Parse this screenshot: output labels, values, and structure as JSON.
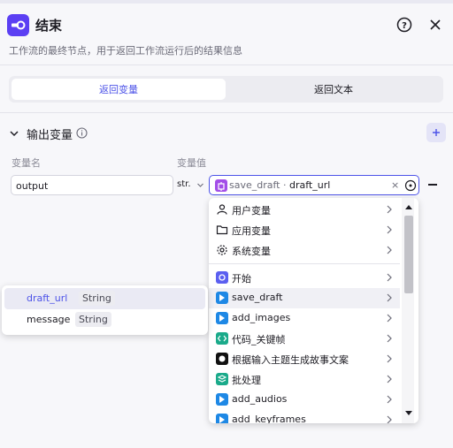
{
  "header": {
    "title": "结束",
    "description": "工作流的最终节点，用于返回工作流运行后的结果信息",
    "icon": "exit-icon",
    "accent": "#5b3ff3"
  },
  "tabs": [
    {
      "label": "返回变量",
      "active": true
    },
    {
      "label": "返回文本",
      "active": false
    }
  ],
  "section": {
    "title": "输出变量",
    "add_label": "+"
  },
  "columns": {
    "name": "变量名",
    "value": "变量值"
  },
  "row": {
    "name": "output",
    "type": "str.",
    "ref_node": "save_draft",
    "ref_sep": "·",
    "ref_field": "draft_url",
    "clear": "×"
  },
  "dropdown": {
    "groups": [
      {
        "label": "用户变量",
        "icon": "user-icon"
      },
      {
        "label": "应用变量",
        "icon": "folder-icon"
      },
      {
        "label": "系统变量",
        "icon": "gear-icon"
      }
    ],
    "nodes": [
      {
        "label": "开始",
        "icon": "start-icon",
        "color": "#5b5ff0"
      },
      {
        "label": "save_draft",
        "icon": "plugin-icon",
        "color": "#1e88e5",
        "highlighted": true
      },
      {
        "label": "add_images",
        "icon": "plugin-icon",
        "color": "#1e88e5"
      },
      {
        "label": "代码_关键帧",
        "icon": "code-icon",
        "color": "#1aaa8a"
      },
      {
        "label": "根据输入主题生成故事文案",
        "icon": "llm-icon",
        "color": "#111111"
      },
      {
        "label": "批处理",
        "icon": "batch-icon",
        "color": "#1aaa8a"
      },
      {
        "label": "add_audios",
        "icon": "plugin-icon",
        "color": "#1e88e5"
      },
      {
        "label": "add_keyframes",
        "icon": "plugin-icon",
        "color": "#1e88e5"
      }
    ]
  },
  "subpopup": {
    "items": [
      {
        "name": "draft_url",
        "type": "String",
        "highlighted": true
      },
      {
        "name": "message",
        "type": "String",
        "highlighted": false
      }
    ]
  }
}
